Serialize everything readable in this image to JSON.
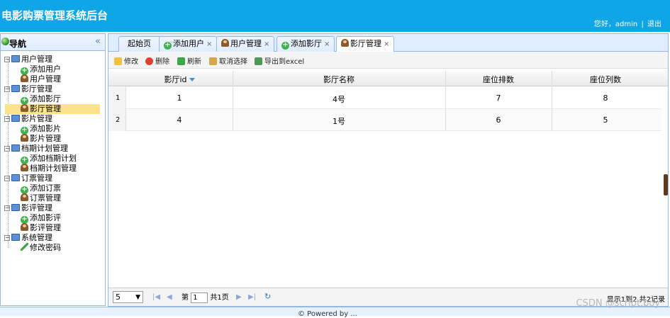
{
  "header": {
    "title": "电影购票管理系统后台",
    "greeting": "您好，admin",
    "separator": "|",
    "logout": "退出"
  },
  "nav": {
    "title": "导航",
    "groups": [
      {
        "label": "用户管理",
        "items": [
          "添加用户",
          "用户管理"
        ]
      },
      {
        "label": "影厅管理",
        "items": [
          "添加影厅",
          "影厅管理"
        ]
      },
      {
        "label": "影片管理",
        "items": [
          "添加影片",
          "影片管理"
        ]
      },
      {
        "label": "档期计划管理",
        "items": [
          "添加档期计划",
          "档期计划管理"
        ]
      },
      {
        "label": "订票管理",
        "items": [
          "添加订票",
          "订票管理"
        ]
      },
      {
        "label": "影评管理",
        "items": [
          "添加影评",
          "影评管理"
        ]
      },
      {
        "label": "系统管理",
        "items": [
          "修改密码"
        ]
      }
    ],
    "selected": "影厅管理"
  },
  "tabs": [
    {
      "label": "起始页",
      "closable": false
    },
    {
      "label": "添加用户",
      "closable": true
    },
    {
      "label": "用户管理",
      "closable": true
    },
    {
      "label": "添加影厅",
      "closable": true
    },
    {
      "label": "影厅管理",
      "closable": true,
      "active": true
    }
  ],
  "toolbar": {
    "edit": "修改",
    "delete": "删除",
    "refresh": "刷新",
    "deselect": "取消选择",
    "export": "导出到excel"
  },
  "grid": {
    "columns": [
      "影厅id",
      "影厅名称",
      "座位排数",
      "座位列数"
    ],
    "rows": [
      {
        "rownum": "1",
        "id": "1",
        "name": "4号",
        "rows": "7",
        "cols": "8"
      },
      {
        "rownum": "2",
        "id": "4",
        "name": "1号",
        "rows": "6",
        "cols": "5"
      }
    ]
  },
  "pager": {
    "page_size": "5",
    "page_prefix": "第",
    "page": "1",
    "page_total": "共1页",
    "summary": "显示1到2,共2记录"
  },
  "footer": {
    "text": "© Powered by ..."
  },
  "watermark": "CSDN @script.boy"
}
